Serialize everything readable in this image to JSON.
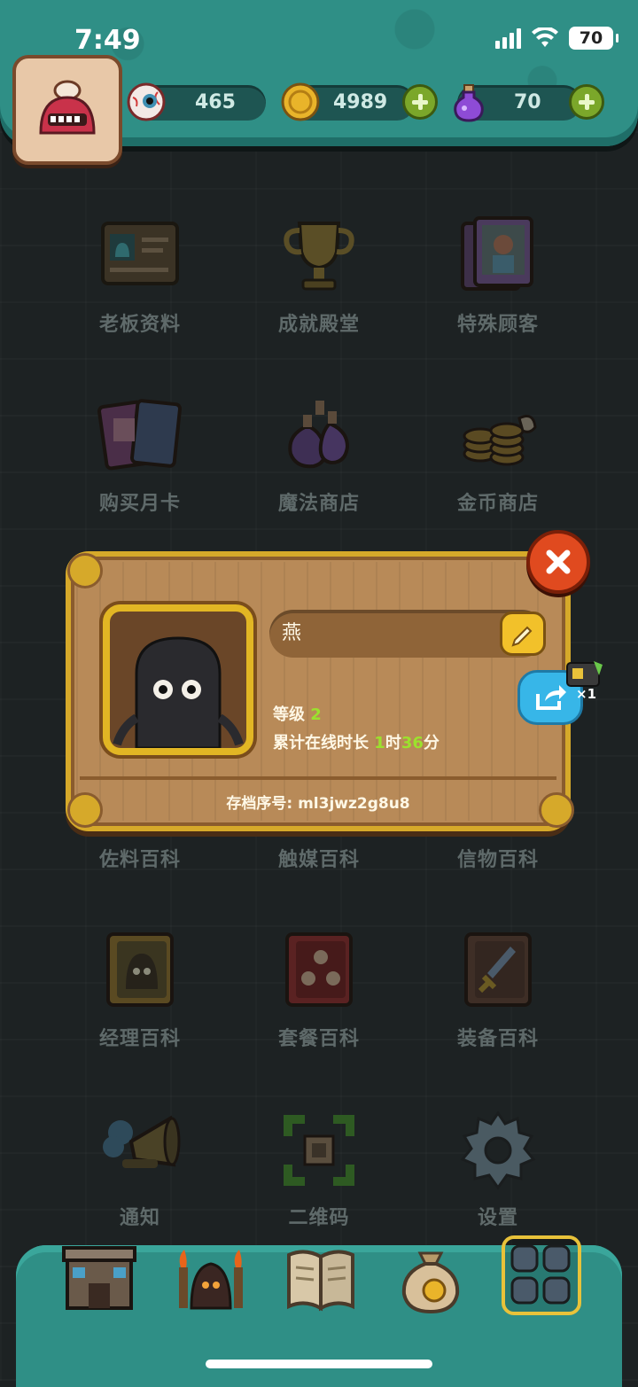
{
  "status_bar": {
    "time": "7:49",
    "battery": "70"
  },
  "resources": {
    "eyeball": {
      "value": "465",
      "icon": "eyeball-icon"
    },
    "coin": {
      "value": "4989",
      "icon": "coin-icon"
    },
    "potion": {
      "value": "70",
      "icon": "potion-icon"
    }
  },
  "menu": {
    "items": [
      {
        "label": "老板资料",
        "icon": "profile-card-icon"
      },
      {
        "label": "成就殿堂",
        "icon": "trophy-icon"
      },
      {
        "label": "特殊顾客",
        "icon": "customer-cards-icon"
      },
      {
        "label": "购买月卡",
        "icon": "monthly-card-icon"
      },
      {
        "label": "魔法商店",
        "icon": "magic-potion-shop-icon"
      },
      {
        "label": "金币商店",
        "icon": "gold-shop-icon"
      },
      {
        "label": "佐料百科",
        "icon": "seasoning-book-icon"
      },
      {
        "label": "触媒百科",
        "icon": "catalyst-book-icon"
      },
      {
        "label": "信物百科",
        "icon": "token-book-icon"
      },
      {
        "label": "经理百科",
        "icon": "manager-book-icon"
      },
      {
        "label": "套餐百科",
        "icon": "meal-book-icon"
      },
      {
        "label": "装备百科",
        "icon": "equipment-book-icon"
      },
      {
        "label": "通知",
        "icon": "megaphone-icon"
      },
      {
        "label": "二维码",
        "icon": "qr-code-icon"
      },
      {
        "label": "设置",
        "icon": "gear-icon"
      }
    ]
  },
  "profile_dialog": {
    "name": "燕",
    "level_label": "等级",
    "level_value": "2",
    "online_label": "累计在线时长",
    "online_hours": "1",
    "hours_unit": "时",
    "online_minutes": "36",
    "minutes_unit": "分",
    "archive_label": "存档序号: ml3jwz2g8u8",
    "share_reward_count": "×1"
  },
  "colors": {
    "accent_teal": "#2f8f86",
    "gold": "#d6a92a",
    "green_text": "#9be22d"
  }
}
